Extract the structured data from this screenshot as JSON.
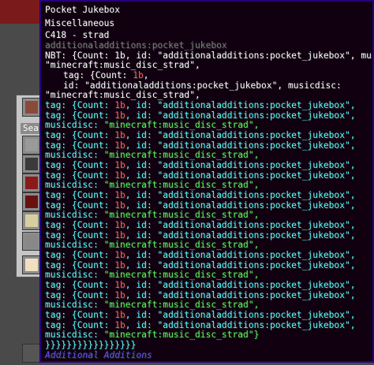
{
  "title": "Pocket Jukebox",
  "category": "Miscellaneous",
  "subtitle": "C418 - strad",
  "item_id": "additionaladditions:pocket_jukebox",
  "nbt_prefix": "NBT: ",
  "nbt_line1": "{Count: 1b, id: \"additionaladditions:pocket_jukebox\", musicdisc:",
  "nbt_line2": "\"minecraft:music_disc_strad\",",
  "tag_open": "tag: {Count: ",
  "count": "1b",
  "comma": ",",
  "id_line": "id: \"additionaladditions:pocket_jukebox\", musicdisc:",
  "musicdisc_line": "\"minecraft:music_disc_strad\",",
  "tag_full_prefix": "tag: {Count: ",
  "id_full": ", id: \"additionaladditions:pocket_jukebox\",",
  "musicdisc_label": "musicdisc: ",
  "musicdisc_value": "\"minecraft:music_disc_strad\",",
  "musicdisc_value_last": "\"minecraft:music_disc_strad\"}",
  "closing": "}}}}}}}}}}}}}}}}}",
  "mod_name": "Additional Additions",
  "search_label": "Sea",
  "colors": {
    "tooltip_bg": "#100010",
    "tooltip_border": "#28007f",
    "aqua": "#55ffff",
    "gold": "#ffaa00",
    "red": "#ff5555",
    "green": "#55ff55",
    "blue": "#5555ff"
  },
  "icons": [
    "jukebox-block-icon",
    "stone-block-icon",
    "deepslate-block-icon",
    "red-block-icon",
    "netherrack-block-icon",
    "sand-block-icon",
    "paper-item-icon"
  ]
}
